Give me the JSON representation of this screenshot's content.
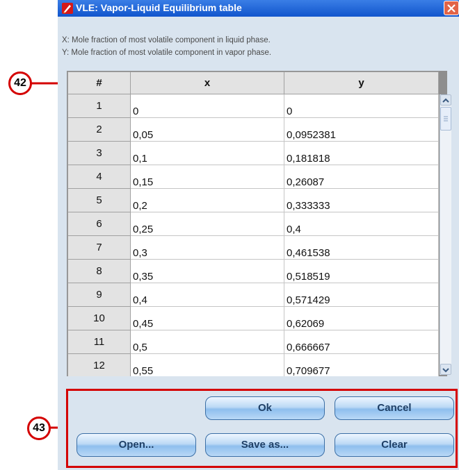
{
  "window": {
    "title": "VLE: Vapor-Liquid Equilibrium table",
    "description_x": "X: Mole fraction of most volatile component in liquid phase.",
    "description_y": "Y: Mole fraction of most volatile component in vapor phase."
  },
  "table": {
    "headers": [
      "#",
      "x",
      "y"
    ],
    "rows": [
      [
        "1",
        "0",
        "0"
      ],
      [
        "2",
        "0,05",
        "0,0952381"
      ],
      [
        "3",
        "0,1",
        "0,181818"
      ],
      [
        "4",
        "0,15",
        "0,26087"
      ],
      [
        "5",
        "0,2",
        "0,333333"
      ],
      [
        "6",
        "0,25",
        "0,4"
      ],
      [
        "7",
        "0,3",
        "0,461538"
      ],
      [
        "8",
        "0,35",
        "0,518519"
      ],
      [
        "9",
        "0,4",
        "0,571429"
      ],
      [
        "10",
        "0,45",
        "0,62069"
      ],
      [
        "11",
        "0,5",
        "0,666667"
      ],
      [
        "12",
        "0,55",
        "0,709677"
      ]
    ]
  },
  "buttons": {
    "ok": "Ok",
    "cancel": "Cancel",
    "open": "Open...",
    "save_as": "Save as...",
    "clear": "Clear"
  },
  "annotations": {
    "callout_table": "42",
    "callout_buttons": "43"
  },
  "colors": {
    "titlebar": "#1a5fd6",
    "annotation_red": "#d40000",
    "window_bg": "#d9e4ef"
  }
}
